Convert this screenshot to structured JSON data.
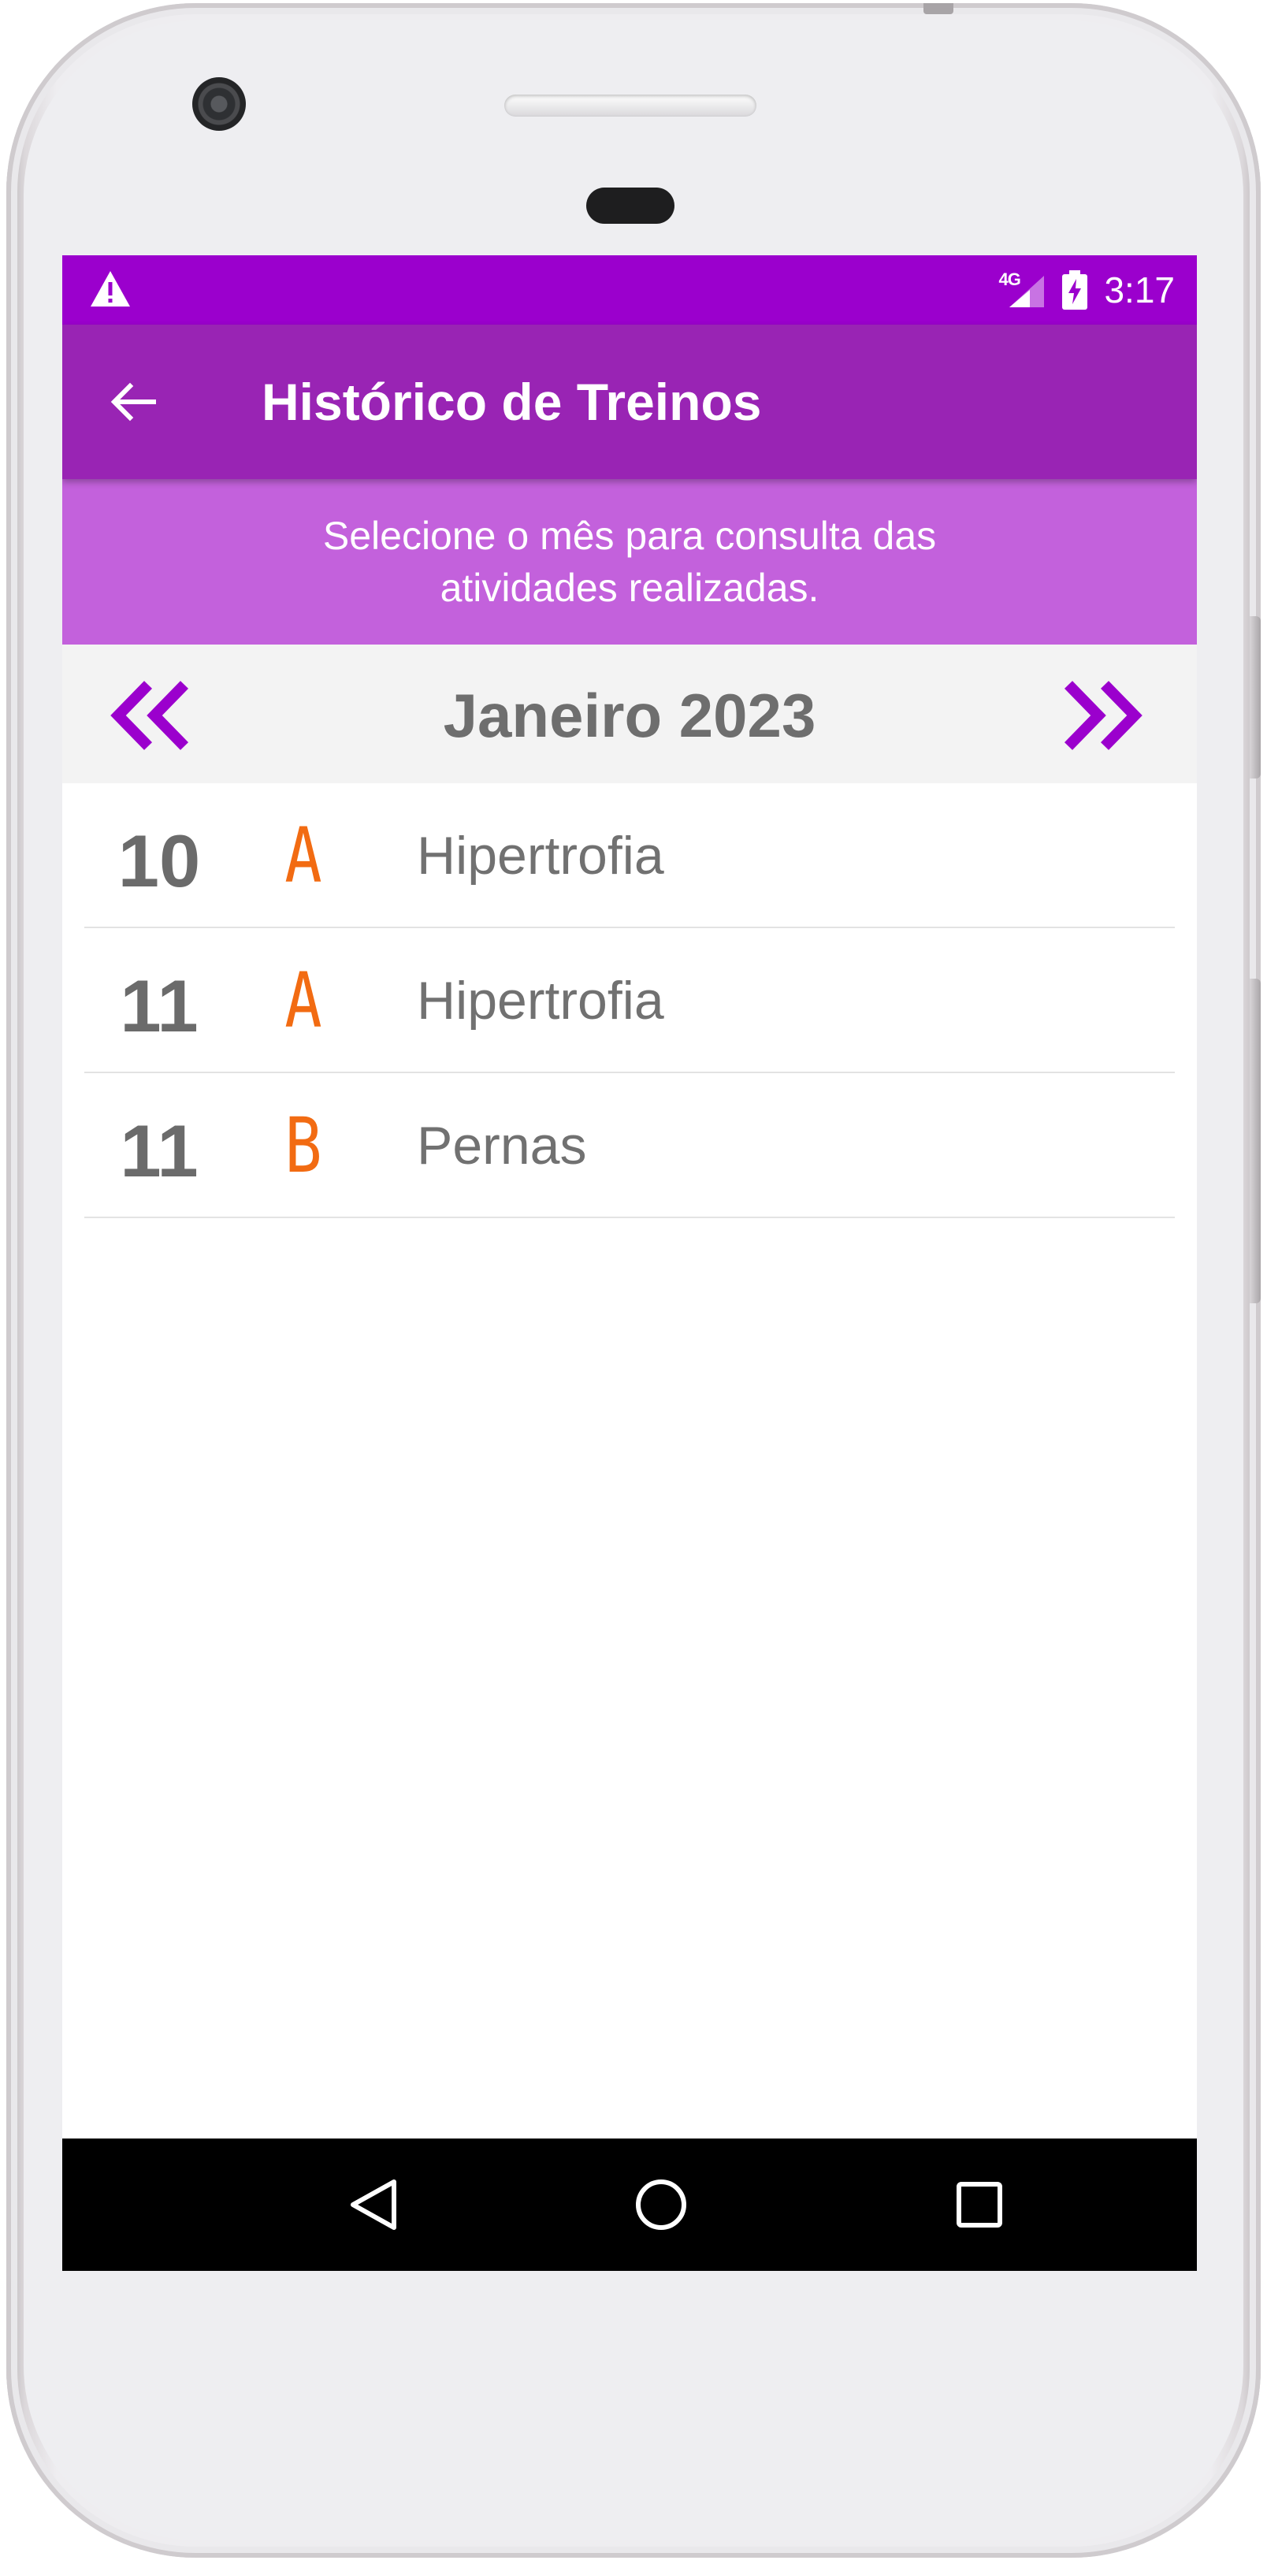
{
  "status_bar": {
    "time": "3:17",
    "network": "4G",
    "icons": [
      "warning-icon",
      "signal-icon",
      "battery-charging-icon"
    ]
  },
  "toolbar": {
    "back_icon": "arrow-back-icon",
    "title": "Histórico de Treinos"
  },
  "info_banner": {
    "text": "Selecione o mês para consulta das atividades realizadas."
  },
  "month_selector": {
    "prev_icon": "double-chevron-left-icon",
    "month_label": "Janeiro 2023",
    "next_icon": "double-chevron-right-icon"
  },
  "workouts": [
    {
      "day": "10",
      "letter": "A",
      "name": "Hipertrofia"
    },
    {
      "day": "11",
      "letter": "A",
      "name": "Hipertrofia"
    },
    {
      "day": "11",
      "letter": "B",
      "name": "Pernas"
    }
  ],
  "navigation_bar": {
    "icons": [
      "nav-back-icon",
      "nav-home-icon",
      "nav-recent-apps-icon"
    ]
  },
  "colors": {
    "status_bar": "#9b00cd",
    "toolbar": "#9924b4",
    "banner": "#c361dc",
    "accent_purple": "#9b00cd",
    "letter_orange": "#f26b12",
    "text_gray": "#6e6e6e"
  }
}
